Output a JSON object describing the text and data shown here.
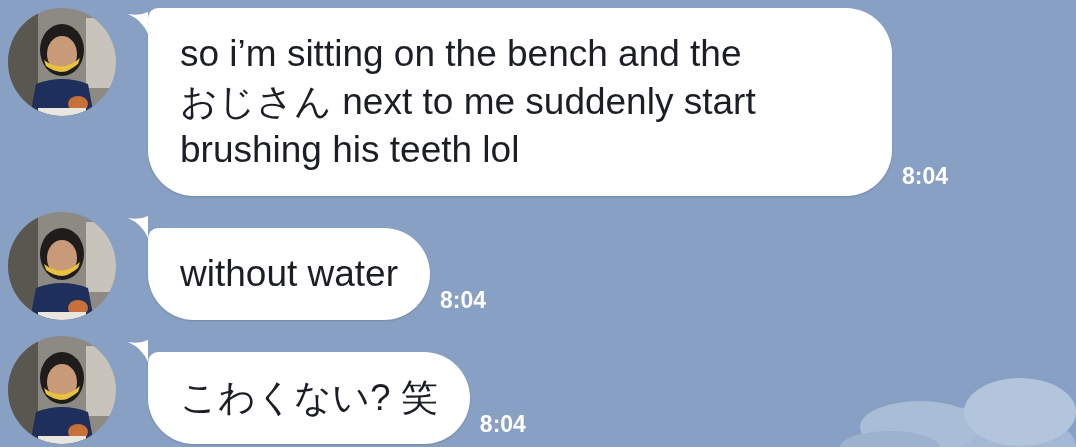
{
  "messages": [
    {
      "text": "so i’m sitting on the bench and the おじさん next to me suddenly start brushing his teeth lol",
      "time": "8:04"
    },
    {
      "text": "without water",
      "time": "8:04"
    },
    {
      "text": "こわくない? 笑",
      "time": "8:04"
    }
  ]
}
